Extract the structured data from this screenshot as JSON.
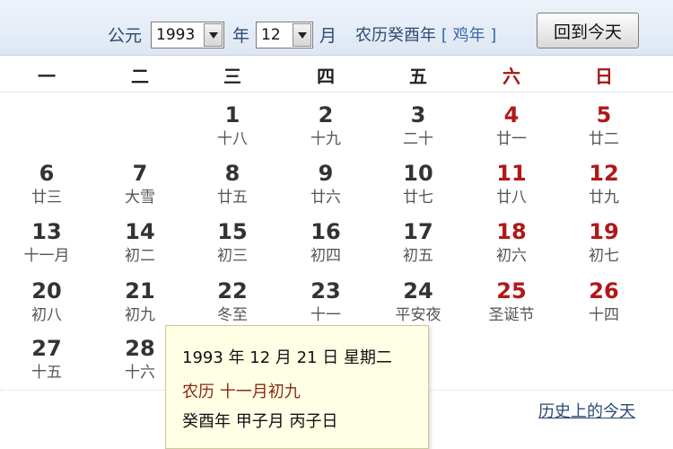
{
  "header": {
    "gregorian_label": "公元",
    "year_value": "1993",
    "year_unit": "年",
    "month_value": "12",
    "month_unit": "月",
    "lunar_year_prefix": "农历癸酉年",
    "zodiac": "[ 鸡年 ]",
    "today_button": "回到今天"
  },
  "weekdays": [
    "一",
    "二",
    "三",
    "四",
    "五",
    "六",
    "日"
  ],
  "days": [
    {
      "num": "1",
      "lunar": "十八"
    },
    {
      "num": "2",
      "lunar": "十九"
    },
    {
      "num": "3",
      "lunar": "二十"
    },
    {
      "num": "4",
      "lunar": "廿一"
    },
    {
      "num": "5",
      "lunar": "廿二"
    },
    {
      "num": "6",
      "lunar": "廿三"
    },
    {
      "num": "7",
      "lunar": "大雪"
    },
    {
      "num": "8",
      "lunar": "廿五"
    },
    {
      "num": "9",
      "lunar": "廿六"
    },
    {
      "num": "10",
      "lunar": "廿七"
    },
    {
      "num": "11",
      "lunar": "廿八"
    },
    {
      "num": "12",
      "lunar": "廿九"
    },
    {
      "num": "13",
      "lunar": "十一月"
    },
    {
      "num": "14",
      "lunar": "初二"
    },
    {
      "num": "15",
      "lunar": "初三"
    },
    {
      "num": "16",
      "lunar": "初四"
    },
    {
      "num": "17",
      "lunar": "初五"
    },
    {
      "num": "18",
      "lunar": "初六"
    },
    {
      "num": "19",
      "lunar": "初七"
    },
    {
      "num": "20",
      "lunar": "初八"
    },
    {
      "num": "21",
      "lunar": "初九"
    },
    {
      "num": "22",
      "lunar": "冬至"
    },
    {
      "num": "23",
      "lunar": "十一"
    },
    {
      "num": "24",
      "lunar": "平安夜"
    },
    {
      "num": "25",
      "lunar": "圣诞节"
    },
    {
      "num": "26",
      "lunar": "十四"
    },
    {
      "num": "27",
      "lunar": "十五"
    },
    {
      "num": "28",
      "lunar": "十六"
    }
  ],
  "tooltip": {
    "line1": "1993 年 12 月 21 日 星期二",
    "line2": "农历 十一月初九",
    "line3": "癸酉年 甲子月 丙子日"
  },
  "footer": {
    "history_link": "历史上的今天"
  },
  "colors": {
    "weekend": "#b01818",
    "header_text": "#2d4a73",
    "tooltip_bg": "#ffffe6"
  }
}
